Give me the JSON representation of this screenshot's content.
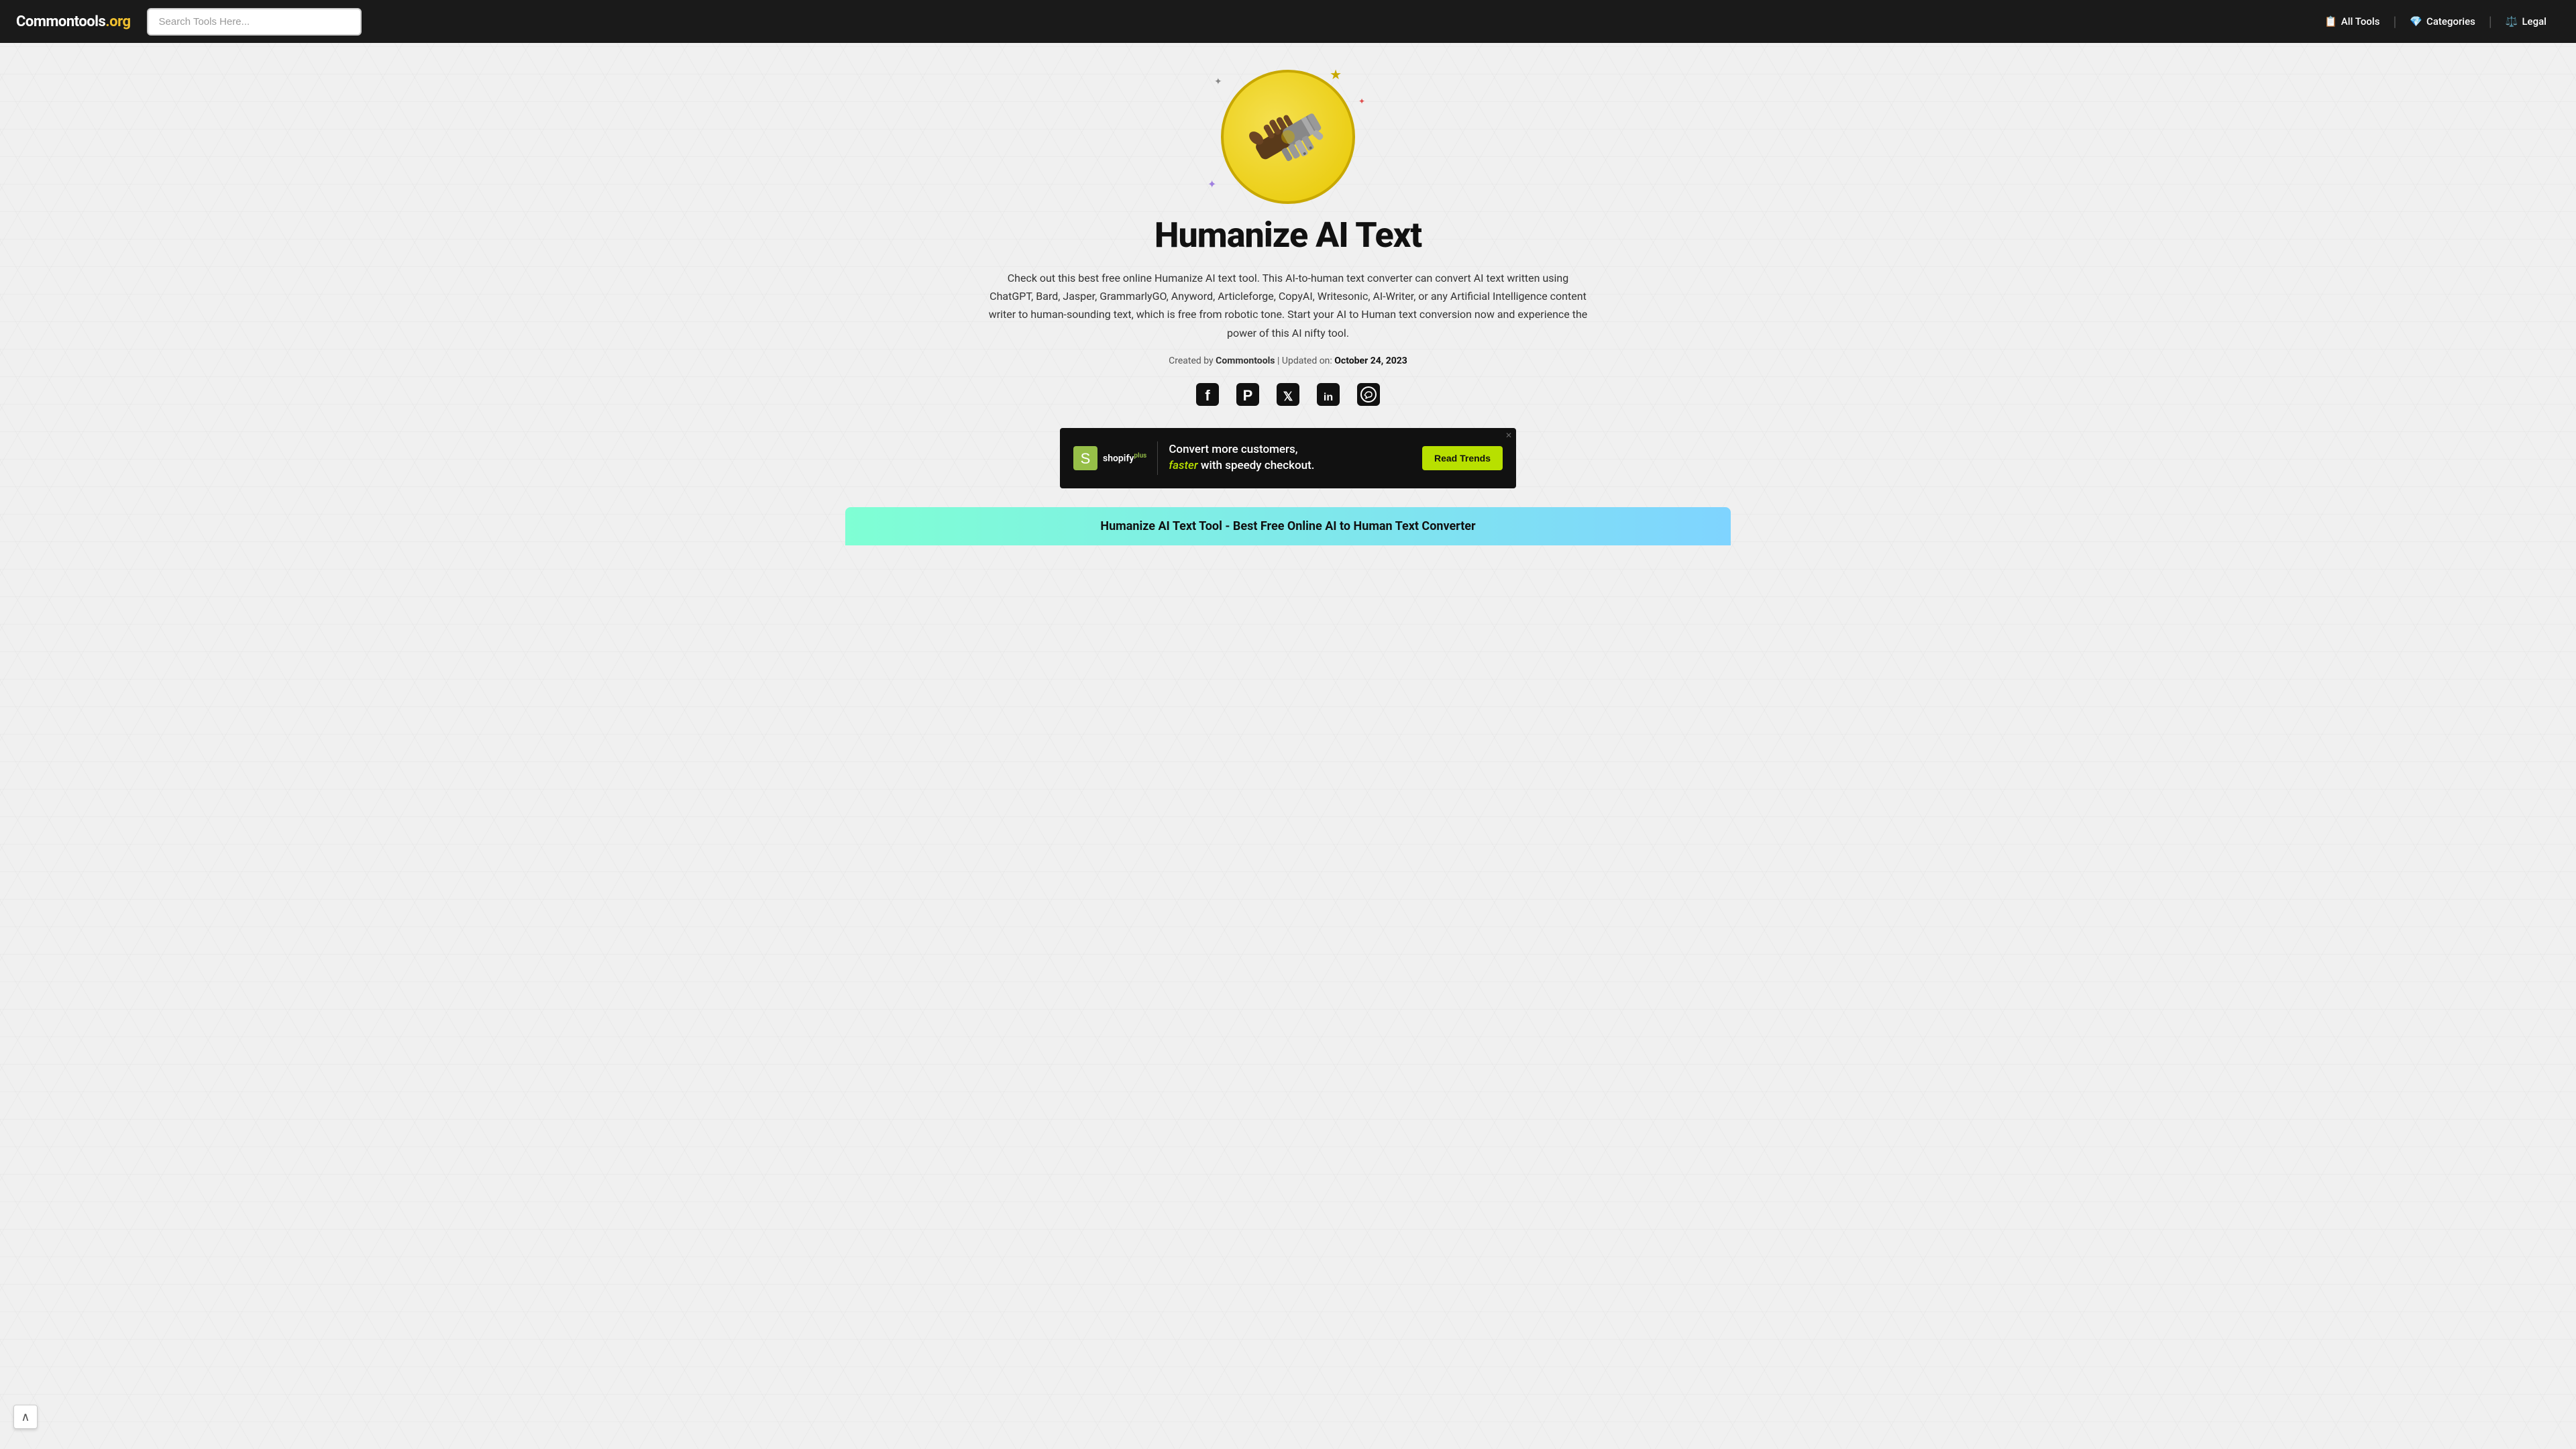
{
  "header": {
    "logo_text_main": "Commontools",
    "logo_text_highlight": ".org",
    "search_placeholder": "Search Tools Here...",
    "nav": [
      {
        "id": "all-tools",
        "icon": "📋",
        "label": "All Tools"
      },
      {
        "id": "categories",
        "icon": "💎",
        "label": "Categories"
      },
      {
        "id": "legal",
        "icon": "⚖️",
        "label": "Legal"
      }
    ]
  },
  "hero": {
    "title": "Humanize AI Text",
    "description": "Check out this best free online Humanize AI text tool. This AI-to-human text converter can convert AI text written using ChatGPT, Bard, Jasper, GrammarlyGO, Anyword, Articleforge, CopyAI, Writesonic, AI-Writer, or any Artificial Intelligence content writer to human-sounding text, which is free from robotic tone. Start your AI to Human text conversion now and experience the power of this AI nifty tool.",
    "meta_created": "Created by",
    "meta_brand": "Commontools",
    "meta_separator": " | Updated on: ",
    "meta_date": "October 24, 2023"
  },
  "social": [
    {
      "id": "facebook",
      "icon": "f",
      "unicode": "📘",
      "label": "Facebook"
    },
    {
      "id": "pinterest",
      "icon": "p",
      "unicode": "📌",
      "label": "Pinterest"
    },
    {
      "id": "twitter",
      "icon": "t",
      "unicode": "🐦",
      "label": "Twitter"
    },
    {
      "id": "linkedin",
      "icon": "in",
      "unicode": "💼",
      "label": "LinkedIn"
    },
    {
      "id": "whatsapp",
      "icon": "w",
      "unicode": "💬",
      "label": "WhatsApp"
    }
  ],
  "ad": {
    "logo_name": "shopify",
    "logo_label": "shopify",
    "logo_suffix": "plus",
    "headline_part1": "Convert more customers,",
    "headline_highlight": "faster",
    "headline_part2": " with speedy checkout.",
    "cta_label": "Read Trends",
    "close_label": "✕"
  },
  "tool_section": {
    "title": "Humanize AI Text Tool - Best Free Online AI to Human Text Converter"
  },
  "scroll_top": {
    "icon": "∧"
  }
}
